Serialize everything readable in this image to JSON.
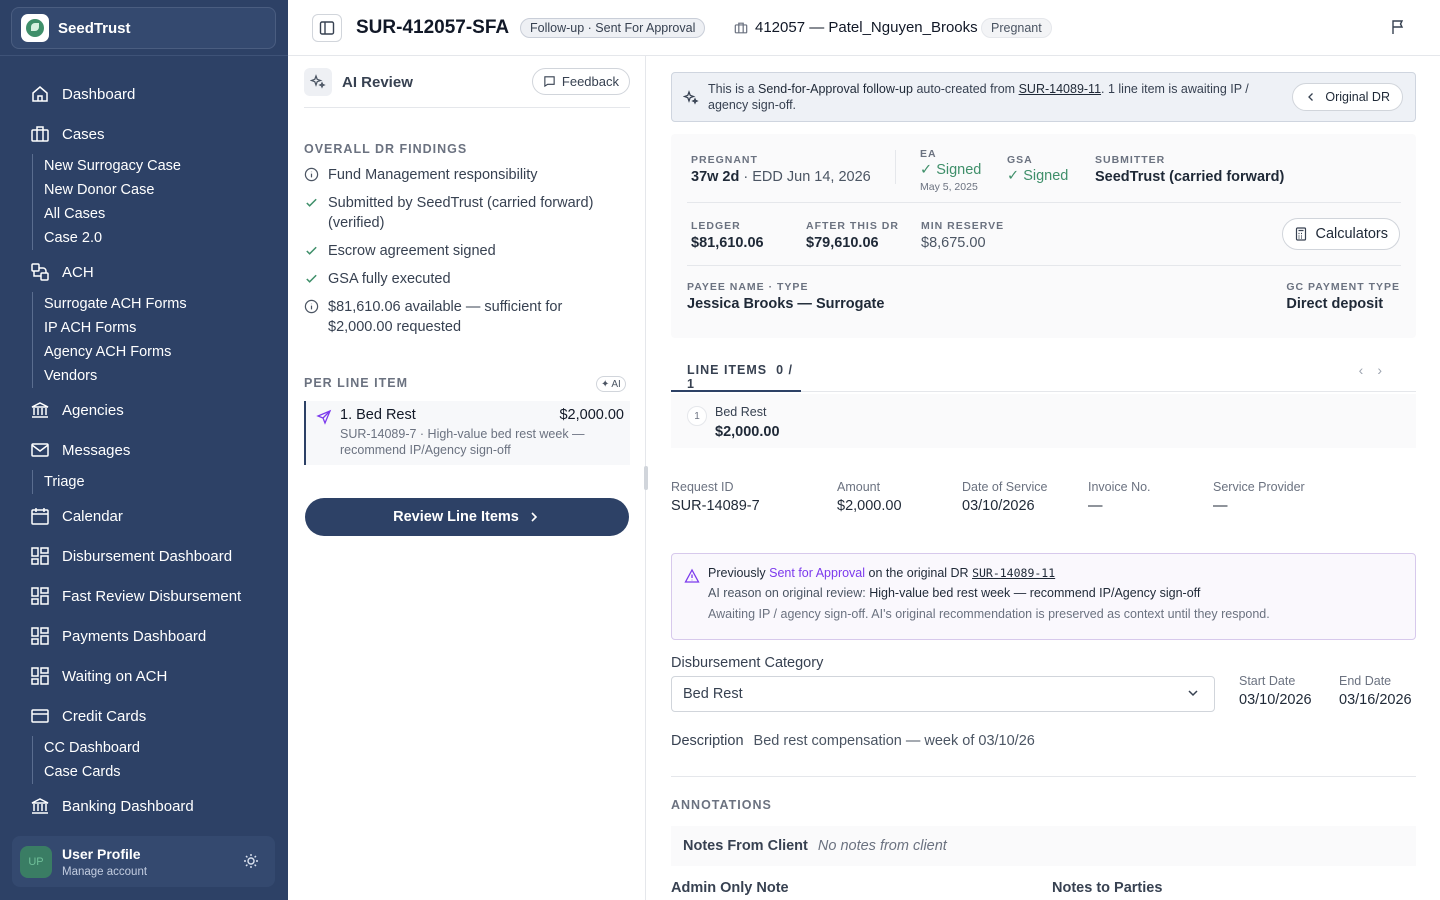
{
  "sidebar": {
    "brand": "SeedTrust",
    "items": [
      {
        "label": "Dashboard",
        "icon": "home-icon"
      },
      {
        "label": "Cases",
        "icon": "briefcase-icon",
        "children": [
          "New Surrogacy Case",
          "New Donor Case",
          "All Cases",
          "Case 2.0"
        ]
      },
      {
        "label": "ACH",
        "icon": "ach-icon",
        "children": [
          "Surrogate ACH Forms",
          "IP ACH Forms",
          "Agency ACH Forms",
          "Vendors"
        ]
      },
      {
        "label": "Agencies",
        "icon": "bank-icon"
      },
      {
        "label": "Messages",
        "icon": "mail-icon",
        "children": [
          "Triage"
        ]
      },
      {
        "label": "Calendar",
        "icon": "calendar-icon"
      },
      {
        "label": "Disbursement Dashboard",
        "icon": "grid-icon"
      },
      {
        "label": "Fast Review Disbursement",
        "icon": "grid-icon"
      },
      {
        "label": "Payments Dashboard",
        "icon": "grid-icon"
      },
      {
        "label": "Waiting on ACH",
        "icon": "grid-icon"
      },
      {
        "label": "Credit Cards",
        "icon": "credit-card-icon",
        "children": [
          "CC Dashboard",
          "Case Cards"
        ]
      },
      {
        "label": "Banking Dashboard",
        "icon": "bank-icon"
      }
    ],
    "user": {
      "initials": "UP",
      "name": "User Profile",
      "sub": "Manage account"
    }
  },
  "header": {
    "case_id": "SUR-412057-SFA",
    "status_pill": "Follow-up · Sent For Approval",
    "case_ref": "412057 — Patel_Nguyen_Brooks",
    "tag": "Pregnant"
  },
  "ai": {
    "title": "AI Review",
    "feedback": "Feedback",
    "overall_label": "OVERALL DR FINDINGS",
    "findings": [
      {
        "icon": "info-icon",
        "text": "Fund Management responsibility"
      },
      {
        "icon": "check-icon",
        "text": "Submitted by SeedTrust (carried forward) (verified)"
      },
      {
        "icon": "check-icon",
        "text": "Escrow agreement signed"
      },
      {
        "icon": "check-icon",
        "text": "GSA fully executed"
      },
      {
        "icon": "info-icon",
        "text": "$81,610.06 available — sufficient for $2,000.00 requested"
      }
    ],
    "per_line_label": "PER LINE ITEM",
    "ai_tag": "AI",
    "line": {
      "title": "1. Bed Rest",
      "amount": "$2,000.00",
      "sub": "SUR-14089-7 · High-value bed rest week — recommend IP/Agency sign-off"
    },
    "review_btn": "Review Line Items"
  },
  "notice": {
    "pre": "This is a ",
    "bold": "Send-for-Approval follow-up",
    "mid": " auto-created from ",
    "link": "SUR-14089-11",
    "post": ". 1 line item is awaiting IP / agency sign-off.",
    "btn": "Original DR"
  },
  "summary": {
    "pregnant_k": "PREGNANT",
    "pregnant_v": "37w 2d",
    "edd": " · EDD Jun 14, 2026",
    "ea_k": "EA",
    "ea_v": "Signed",
    "ea_date": "May 5, 2025",
    "gsa_k": "GSA",
    "gsa_v": "Signed",
    "sub_k": "SUBMITTER",
    "sub_v": "SeedTrust (carried forward)",
    "ledger_k": "LEDGER",
    "ledger_v": "$81,610.06",
    "after_k": "AFTER THIS DR",
    "after_v": "$79,610.06",
    "min_k": "MIN RESERVE",
    "min_v": "$8,675.00",
    "calc": "Calculators",
    "payee_k": "PAYEE NAME · TYPE",
    "payee_v": "Jessica Brooks — Surrogate",
    "gc_k": "GC PAYMENT TYPE",
    "gc_v": "Direct deposit"
  },
  "line_items": {
    "label": "LINE ITEMS",
    "count": "0 / 1",
    "items": [
      {
        "num": "1",
        "title": "Bed Rest",
        "amount": "$2,000.00"
      }
    ]
  },
  "fields": [
    {
      "k": "Request ID",
      "v": "SUR-14089-7"
    },
    {
      "k": "Amount",
      "v": "$2,000.00"
    },
    {
      "k": "Date of Service",
      "v": "03/10/2026"
    },
    {
      "k": "Invoice No.",
      "v": "—"
    },
    {
      "k": "Service Provider",
      "v": "—"
    }
  ],
  "warning": {
    "pre": "Previously ",
    "purple": "Sent for Approval",
    "mid": " on the original DR ",
    "link": "SUR-14089-11",
    "reason_k": "AI reason on original review: ",
    "reason_v": "High-value bed rest week — recommend IP/Agency sign-off",
    "await": "Awaiting IP / agency sign-off. AI's original recommendation is preserved as context until they respond."
  },
  "category": {
    "label": "Disbursement Category",
    "value": "Bed Rest",
    "start_k": "Start Date",
    "start_v": "03/10/2026",
    "end_k": "End Date",
    "end_v": "03/16/2026"
  },
  "description": {
    "label": "Description",
    "value": "Bed rest compensation — week of 03/10/26"
  },
  "annotations": {
    "label": "ANNOTATIONS",
    "client_k": "Notes From Client",
    "client_v": "No notes from client",
    "admin_k": "Admin Only Note",
    "parties_k": "Notes to Parties"
  }
}
